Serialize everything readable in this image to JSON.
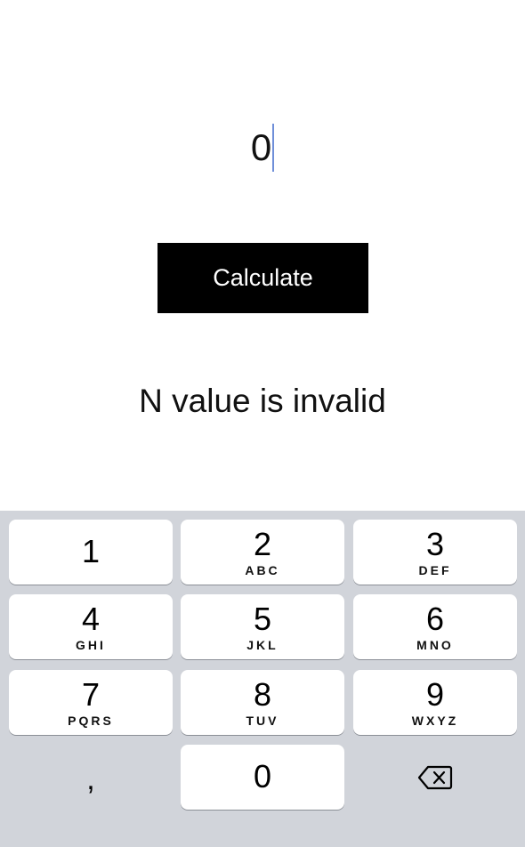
{
  "input": {
    "value": "0"
  },
  "calculate_button": {
    "label": "Calculate"
  },
  "result": {
    "message": "N value is invalid"
  },
  "keypad": {
    "keys": [
      {
        "digit": "1",
        "letters": ""
      },
      {
        "digit": "2",
        "letters": "ABC"
      },
      {
        "digit": "3",
        "letters": "DEF"
      },
      {
        "digit": "4",
        "letters": "GHI"
      },
      {
        "digit": "5",
        "letters": "JKL"
      },
      {
        "digit": "6",
        "letters": "MNO"
      },
      {
        "digit": "7",
        "letters": "PQRS"
      },
      {
        "digit": "8",
        "letters": "TUV"
      },
      {
        "digit": "9",
        "letters": "WXYZ"
      },
      {
        "digit": "0",
        "letters": ""
      }
    ],
    "decimal_label": ",",
    "delete_icon": "backspace-icon"
  },
  "colors": {
    "caret": "#6f8fd9",
    "button_bg": "#000000",
    "keyboard_bg": "#d1d4da"
  }
}
